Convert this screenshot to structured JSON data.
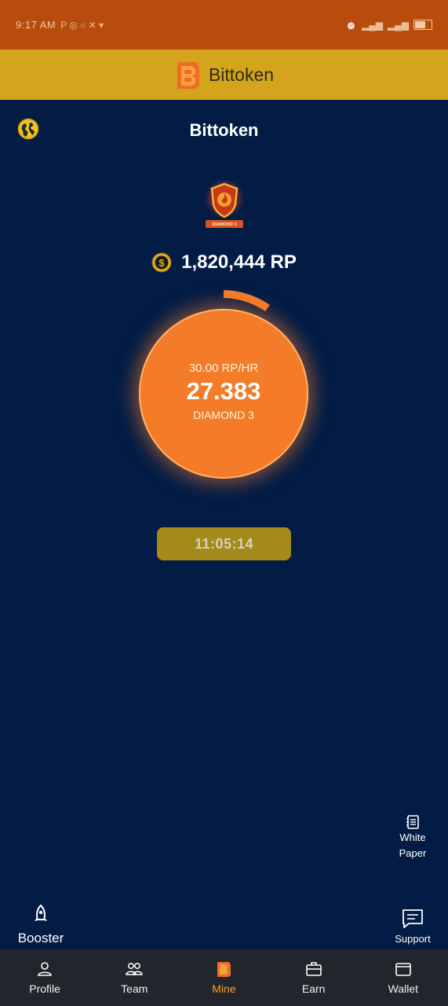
{
  "status_bar": {
    "time": "9:17 AM"
  },
  "app_header": {
    "brand_name": "Bittoken"
  },
  "page": {
    "title": "Bittoken"
  },
  "rank": {
    "badge_text": "DIAMOND 3"
  },
  "balance": {
    "text": "1,820,444 RP"
  },
  "mining": {
    "rate": "30.00 RP/HR",
    "value": "27.383",
    "level": "DIAMOND 3",
    "timer": "11:05:14"
  },
  "floating": {
    "white_paper_line1": "White",
    "white_paper_line2": "Paper",
    "support": "Support",
    "booster": "Booster"
  },
  "nav": {
    "items": [
      {
        "label": "Profile",
        "icon": "person-icon"
      },
      {
        "label": "Team",
        "icon": "team-icon"
      },
      {
        "label": "Mine",
        "icon": "bittoken-logo-icon",
        "active": true
      },
      {
        "label": "Earn",
        "icon": "briefcase-icon"
      },
      {
        "label": "Wallet",
        "icon": "wallet-icon"
      }
    ]
  },
  "colors": {
    "background": "#021c45",
    "header": "#d4a51c",
    "status_bar": "#b84c0c",
    "orb": "#f47b28",
    "active_nav": "#f6a622"
  }
}
